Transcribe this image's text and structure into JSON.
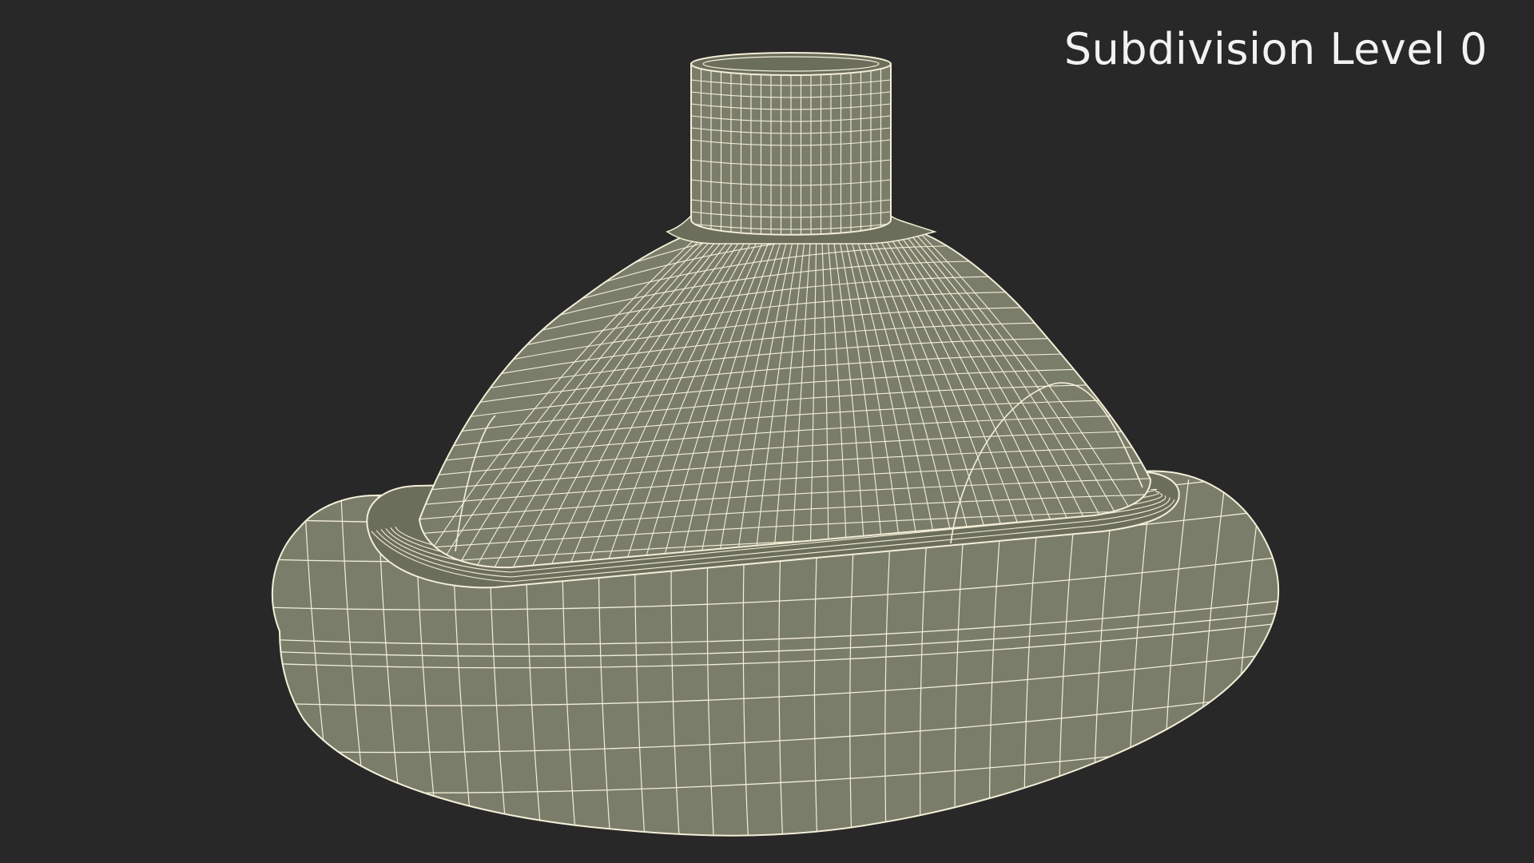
{
  "overlay": {
    "subdivision_label": "Subdivision Level 0"
  },
  "colors": {
    "background": "#282828",
    "mesh_fill": "#7b7d6b",
    "mesh_fill_dark": "#6c6e5c",
    "wireframe": "#f3efd8"
  },
  "icons": {
    "model": "wireframe-mask-model"
  }
}
